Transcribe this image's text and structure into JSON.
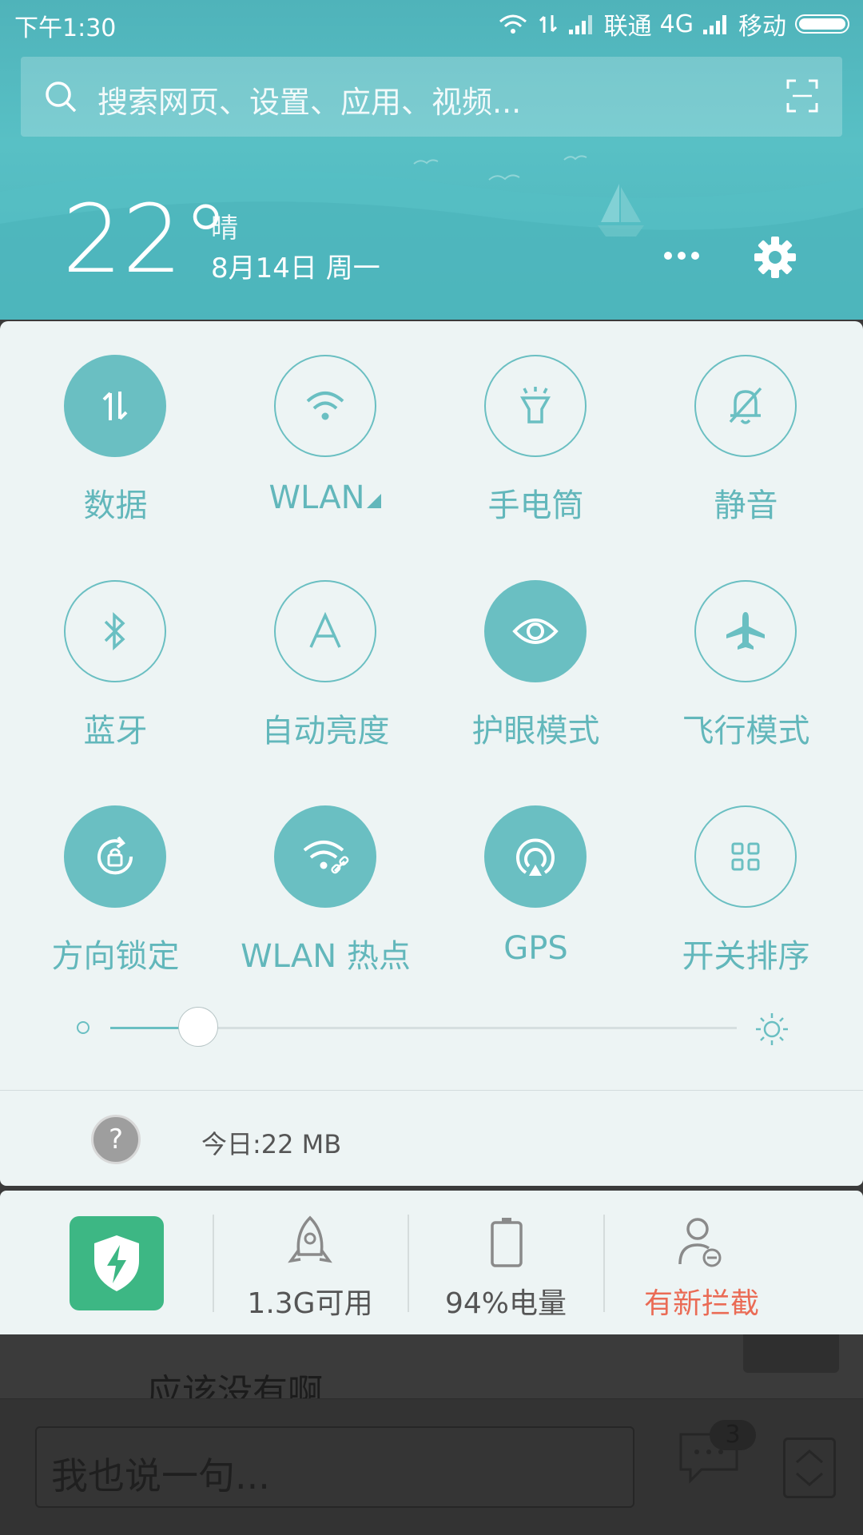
{
  "status_bar": {
    "time": "下午1:30",
    "carrier1": "联通",
    "network1": "4G",
    "carrier2": "移动"
  },
  "search": {
    "placeholder": "搜索网页、设置、应用、视频..."
  },
  "weather": {
    "temperature": "22°",
    "condition": "晴",
    "date": "8月14日 周一"
  },
  "tiles": [
    {
      "label": "数据",
      "icon": "data-icon",
      "active": true
    },
    {
      "label": "WLAN",
      "icon": "wifi-icon",
      "active": false
    },
    {
      "label": "手电筒",
      "icon": "flashlight-icon",
      "active": false
    },
    {
      "label": "静音",
      "icon": "mute-bell-icon",
      "active": false
    },
    {
      "label": "蓝牙",
      "icon": "bluetooth-icon",
      "active": false
    },
    {
      "label": "自动亮度",
      "icon": "auto-brightness-icon",
      "active": false
    },
    {
      "label": "护眼模式",
      "icon": "eye-icon",
      "active": true
    },
    {
      "label": "飞行模式",
      "icon": "airplane-icon",
      "active": false
    },
    {
      "label": "方向锁定",
      "icon": "rotation-lock-icon",
      "active": true
    },
    {
      "label": "WLAN 热点",
      "icon": "hotspot-icon",
      "active": true
    },
    {
      "label": "GPS",
      "icon": "gps-icon",
      "active": true
    },
    {
      "label": "开关排序",
      "icon": "grid-icon",
      "active": false
    }
  ],
  "brightness": {
    "level": 0.14
  },
  "data_usage": {
    "text": "今日:22 MB"
  },
  "security_bar": {
    "memory": "1.3G可用",
    "battery": "94%电量",
    "blocked": "有新拦截",
    "alert_color": "#ea6b55"
  },
  "underlying_app": {
    "partial_text": "应该没有啊",
    "comment_placeholder": "我也说一句...",
    "comment_count": "3"
  },
  "colors": {
    "accent": "#6abfc2",
    "header": "#4fb3ba",
    "security_green": "#3db784"
  }
}
